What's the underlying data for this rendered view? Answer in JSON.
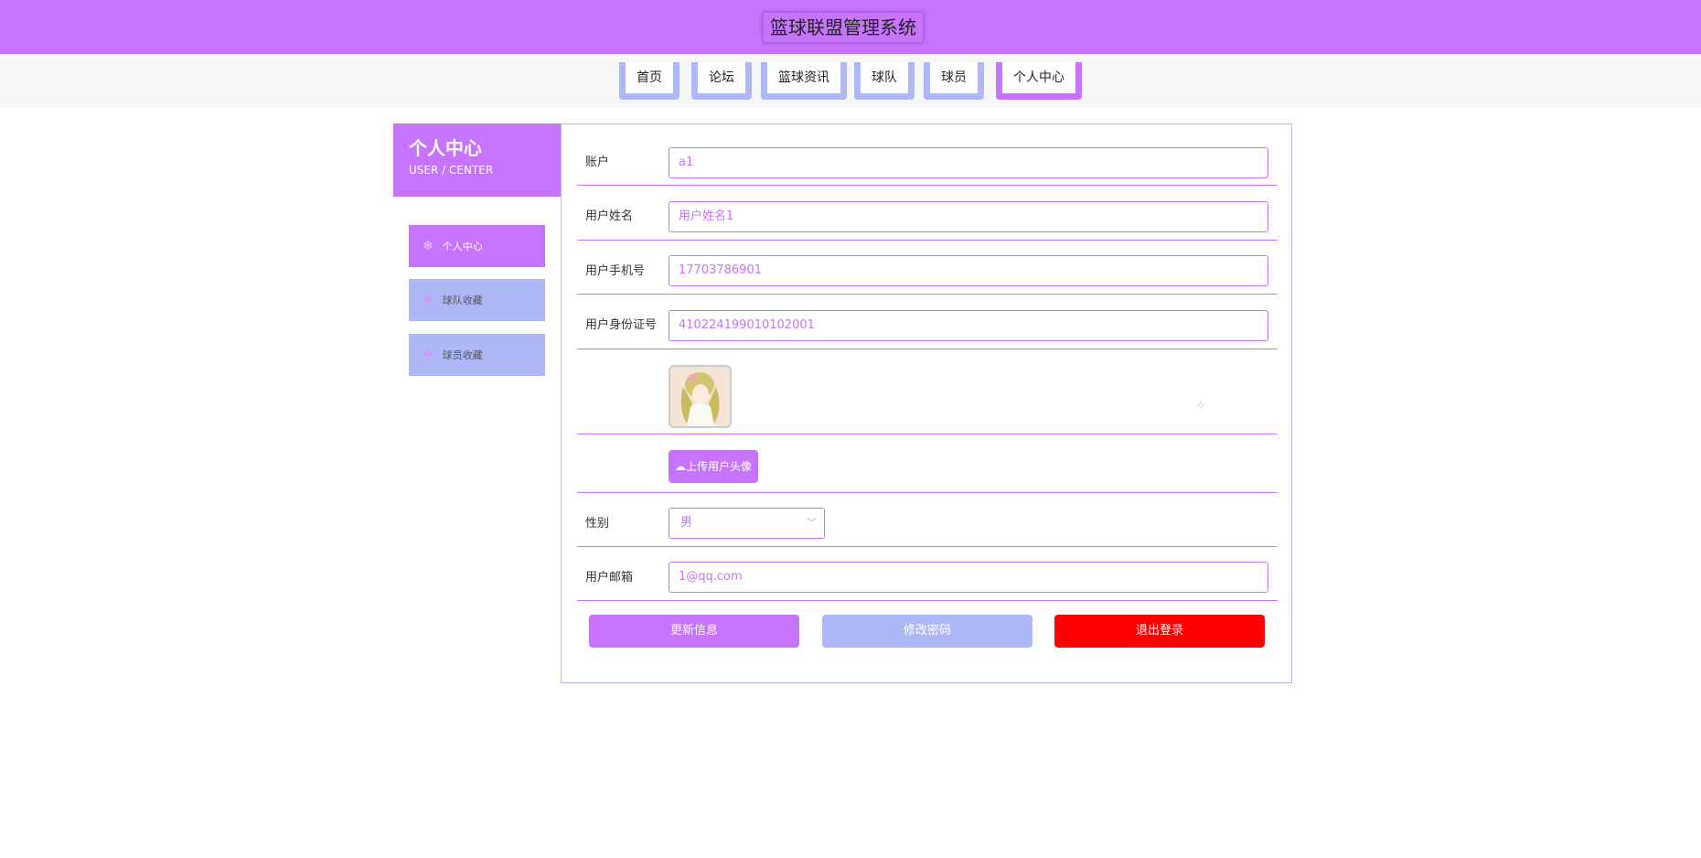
{
  "header": {
    "title": "篮球联盟管理系统"
  },
  "nav": [
    {
      "label": "首页"
    },
    {
      "label": "论坛"
    },
    {
      "label": "篮球资讯"
    },
    {
      "label": "球队"
    },
    {
      "label": "球员"
    },
    {
      "label": "个人中心"
    }
  ],
  "sidebar": {
    "title": "个人中心",
    "subtitle": "USER / CENTER",
    "items": [
      {
        "label": "个人中心"
      },
      {
        "label": "球队收藏"
      },
      {
        "label": "球员收藏"
      }
    ]
  },
  "form": {
    "account": {
      "label": "账户",
      "value": "a1"
    },
    "name": {
      "label": "用户姓名",
      "value": "用户姓名1"
    },
    "phone": {
      "label": "用户手机号",
      "value": "17703786901"
    },
    "id_card": {
      "label": "用户身份证号",
      "value": "410224199010102001"
    },
    "upload_label": "上传用户头像",
    "gender": {
      "label": "性别",
      "value": "男"
    },
    "email": {
      "label": "用户邮箱",
      "value": "1@qq.com"
    }
  },
  "actions": {
    "update": "更新信息",
    "change_password": "修改密码",
    "logout": "退出登录"
  },
  "colors": {
    "primary": "#c674fd",
    "secondary": "#aeb8f6",
    "danger": "#ff0000"
  }
}
